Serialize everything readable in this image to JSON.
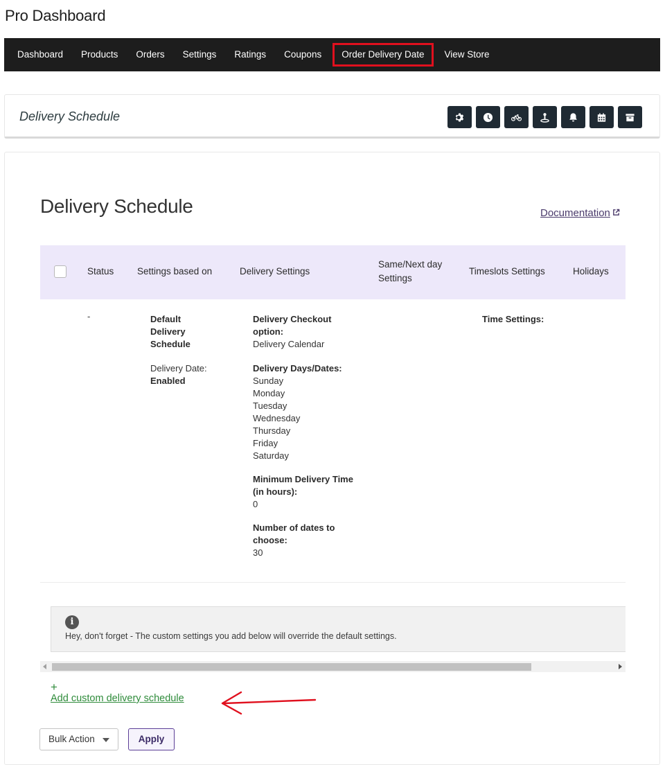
{
  "app": {
    "title": "Pro Dashboard"
  },
  "nav": {
    "items": [
      {
        "label": "Dashboard"
      },
      {
        "label": "Products"
      },
      {
        "label": "Orders"
      },
      {
        "label": "Settings"
      },
      {
        "label": "Ratings"
      },
      {
        "label": "Coupons"
      },
      {
        "label": "Order Delivery Date",
        "highlighted": true
      },
      {
        "label": "View Store"
      }
    ]
  },
  "header_card": {
    "title": "Delivery Schedule",
    "icons": [
      "gear-icon",
      "clock-icon",
      "bicycle-icon",
      "location-pin-icon",
      "bell-icon",
      "calendar-icon",
      "archive-icon"
    ]
  },
  "main": {
    "title": "Delivery Schedule",
    "documentation_label": "Documentation"
  },
  "table": {
    "headers": {
      "status": "Status",
      "settings_based_on": "Settings based on",
      "delivery_settings": "Delivery Settings",
      "same_next_day_line1": "Same/Next day",
      "same_next_day_line2": "Settings",
      "timeslots": "Timeslots Settings",
      "holidays": "Holidays"
    },
    "row": {
      "status": "-",
      "settings_based_on": {
        "name_line1": "Default",
        "name_line2": "Delivery",
        "name_line3": "Schedule",
        "delivery_date_label": "Delivery Date:",
        "delivery_date_value": "Enabled"
      },
      "delivery_settings": {
        "checkout_label_line1": "Delivery Checkout",
        "checkout_label_line2": "option:",
        "checkout_value": "Delivery Calendar",
        "days_label": "Delivery Days/Dates:",
        "days": [
          "Sunday",
          "Monday",
          "Tuesday",
          "Wednesday",
          "Thursday",
          "Friday",
          "Saturday"
        ],
        "min_time_label_line1": "Minimum Delivery Time",
        "min_time_label_line2": "(in hours):",
        "min_time_value": "0",
        "num_dates_label_line1": "Number of dates to",
        "num_dates_label_line2": "choose:",
        "num_dates_value": "30"
      },
      "timeslots": {
        "time_settings_label": "Time Settings:"
      }
    }
  },
  "notice": {
    "icon": "info-icon",
    "message": "Hey, don't forget - The custom settings you add below will override the default settings."
  },
  "add_custom": {
    "plus": "+",
    "label": "Add custom delivery schedule"
  },
  "bulk": {
    "select_value": "Bulk Action",
    "apply_label": "Apply"
  },
  "colors": {
    "nav_bg": "#1d1d1d",
    "highlight": "#e0101e",
    "table_header_bg": "#ede8fa",
    "link_green": "#2e8b3a",
    "apply_border": "#5b3e96"
  }
}
